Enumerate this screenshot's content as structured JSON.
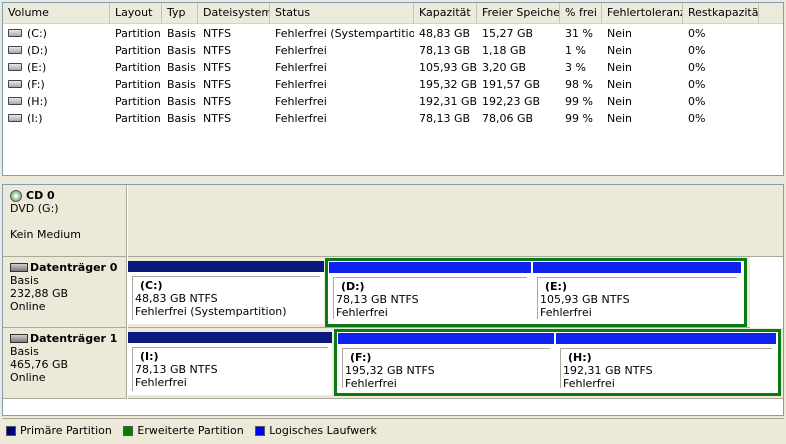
{
  "columns": [
    "Volume",
    "Layout",
    "Typ",
    "Dateisystem",
    "Status",
    "Kapazität",
    "Freier Speicher",
    "% frei",
    "Fehlertoleranz",
    "Restkapazität"
  ],
  "volumes": [
    {
      "volume": "(C:)",
      "layout": "Partition",
      "typ": "Basis",
      "fs": "NTFS",
      "status": "Fehlerfrei (Systempartition)",
      "kapazitaet": "48,83 GB",
      "frei": "15,27 GB",
      "prozent": "31 %",
      "fehlertoleranz": "Nein",
      "rest": "0%"
    },
    {
      "volume": "(D:)",
      "layout": "Partition",
      "typ": "Basis",
      "fs": "NTFS",
      "status": "Fehlerfrei",
      "kapazitaet": "78,13 GB",
      "frei": "1,18 GB",
      "prozent": "1 %",
      "fehlertoleranz": "Nein",
      "rest": "0%"
    },
    {
      "volume": "(E:)",
      "layout": "Partition",
      "typ": "Basis",
      "fs": "NTFS",
      "status": "Fehlerfrei",
      "kapazitaet": "105,93 GB",
      "frei": "3,20 GB",
      "prozent": "3 %",
      "fehlertoleranz": "Nein",
      "rest": "0%"
    },
    {
      "volume": "(F:)",
      "layout": "Partition",
      "typ": "Basis",
      "fs": "NTFS",
      "status": "Fehlerfrei",
      "kapazitaet": "195,32 GB",
      "frei": "191,57 GB",
      "prozent": "98 %",
      "fehlertoleranz": "Nein",
      "rest": "0%"
    },
    {
      "volume": "(H:)",
      "layout": "Partition",
      "typ": "Basis",
      "fs": "NTFS",
      "status": "Fehlerfrei",
      "kapazitaet": "192,31 GB",
      "frei": "192,23 GB",
      "prozent": "99 %",
      "fehlertoleranz": "Nein",
      "rest": "0%"
    },
    {
      "volume": "(I:)",
      "layout": "Partition",
      "typ": "Basis",
      "fs": "NTFS",
      "status": "Fehlerfrei",
      "kapazitaet": "78,13 GB",
      "frei": "78,06 GB",
      "prozent": "99 %",
      "fehlertoleranz": "Nein",
      "rest": "0%"
    }
  ],
  "cd0": {
    "name": "CD 0",
    "type": "DVD (G:)",
    "medium": "Kein Medium"
  },
  "disk0": {
    "name": "Datenträger 0",
    "type": "Basis",
    "size": "232,88 GB",
    "state": "Online",
    "parts": [
      {
        "label": "(C:)",
        "size": "48,83 GB NTFS",
        "status": "Fehlerfrei (Systempartition)"
      },
      {
        "label": "(D:)",
        "size": "78,13 GB NTFS",
        "status": "Fehlerfrei"
      },
      {
        "label": "(E:)",
        "size": "105,93 GB NTFS",
        "status": "Fehlerfrei"
      }
    ]
  },
  "disk1": {
    "name": "Datenträger 1",
    "type": "Basis",
    "size": "465,76 GB",
    "state": "Online",
    "parts": [
      {
        "label": "(I:)",
        "size": "78,13 GB NTFS",
        "status": "Fehlerfrei"
      },
      {
        "label": "(F:)",
        "size": "195,32 GB NTFS",
        "status": "Fehlerfrei"
      },
      {
        "label": "(H:)",
        "size": "192,31 GB NTFS",
        "status": "Fehlerfrei"
      }
    ]
  },
  "legend": [
    {
      "label": "Primäre Partition",
      "color": "#00007f"
    },
    {
      "label": "Erweiterte Partition",
      "color": "#008000"
    },
    {
      "label": "Logisches Laufwerk",
      "color": "#0000ff"
    }
  ],
  "colors": {
    "primary": "#0a1a7c",
    "logical": "#0f22f0",
    "extended": "#0b7a16"
  }
}
